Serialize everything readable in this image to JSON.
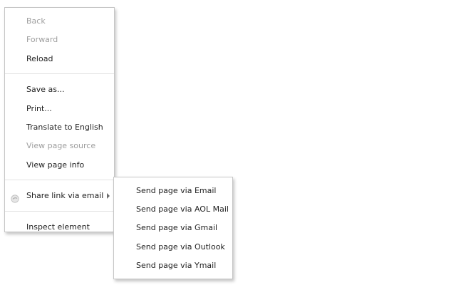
{
  "context_menu": {
    "groups": [
      {
        "items": [
          {
            "label": "Back",
            "enabled": false
          },
          {
            "label": "Forward",
            "enabled": false
          },
          {
            "label": "Reload",
            "enabled": true
          }
        ]
      },
      {
        "items": [
          {
            "label": "Save as...",
            "enabled": true
          },
          {
            "label": "Print...",
            "enabled": true
          },
          {
            "label": "Translate to English",
            "enabled": true
          },
          {
            "label": "View page source",
            "enabled": false
          },
          {
            "label": "View page info",
            "enabled": true
          }
        ]
      },
      {
        "items": [
          {
            "label": "Share link via email",
            "enabled": true,
            "icon": "share-email-icon",
            "has_submenu": true
          }
        ]
      },
      {
        "items": [
          {
            "label": "Inspect element",
            "enabled": true
          }
        ]
      }
    ]
  },
  "submenu": {
    "items": [
      {
        "label": "Send page via Email"
      },
      {
        "label": "Send page via AOL Mail"
      },
      {
        "label": "Send page via Gmail"
      },
      {
        "label": "Send page via Outlook"
      },
      {
        "label": "Send page via Ymail"
      }
    ]
  },
  "colors": {
    "text": "#222222",
    "disabled_text": "#9e9e9e",
    "border": "#c6c6c6",
    "separator": "#e2e2e2"
  }
}
